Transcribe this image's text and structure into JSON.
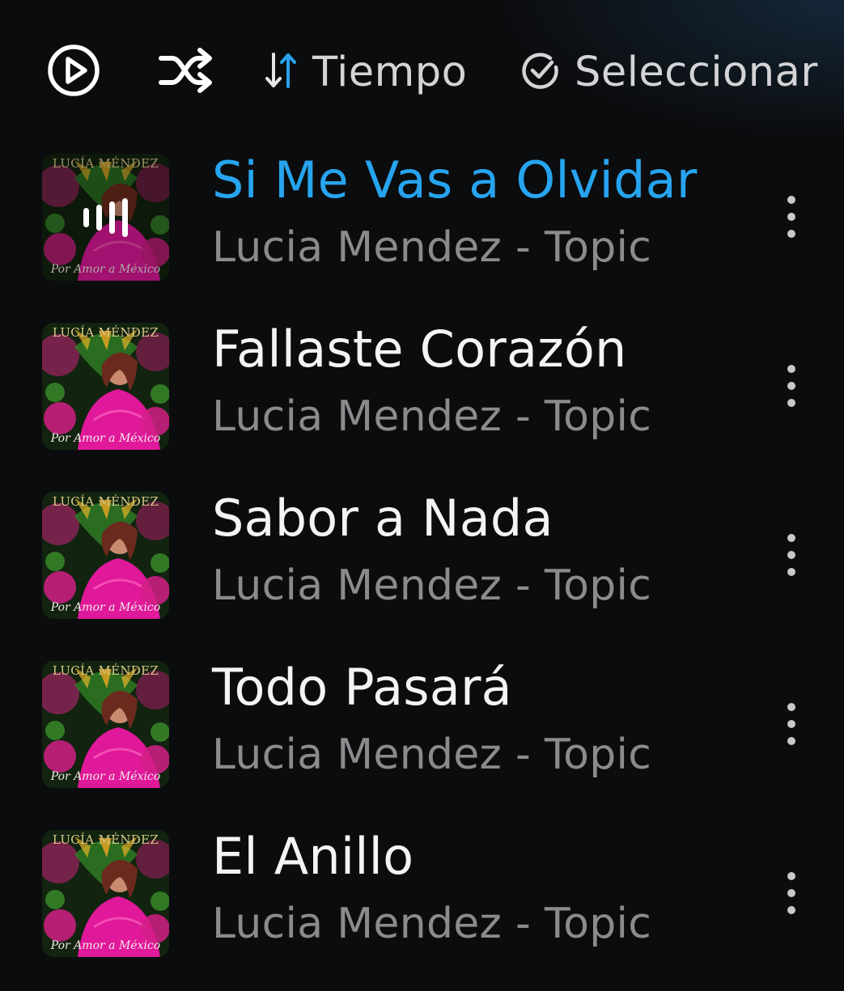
{
  "toolbar": {
    "play_icon": "play-circle-icon",
    "shuffle_icon": "shuffle-icon",
    "sort_icon": "sort-arrows-icon",
    "sort_label": "Tiempo",
    "select_icon": "check-circle-icon",
    "select_label": "Seleccionar"
  },
  "colors": {
    "background": "#0b0c0e",
    "now_playing_accent": "#27a4ef",
    "primary_text": "#f4f4f6",
    "secondary_text": "#8b8b8e"
  },
  "songs": [
    {
      "title": "Si Me Vas a Olvidar",
      "artist": "Lucia Mendez - Topic",
      "now_playing": true,
      "cover_artist": "LUCÍA MÉNDEZ",
      "cover_album": "Por Amor a México"
    },
    {
      "title": "Fallaste Corazón",
      "artist": "Lucia Mendez - Topic",
      "now_playing": false,
      "cover_artist": "LUCÍA MÉNDEZ",
      "cover_album": "Por Amor a México"
    },
    {
      "title": "Sabor a Nada",
      "artist": "Lucia Mendez - Topic",
      "now_playing": false,
      "cover_artist": "LUCÍA MÉNDEZ",
      "cover_album": "Por Amor a México"
    },
    {
      "title": "Todo Pasará",
      "artist": "Lucia Mendez - Topic",
      "now_playing": false,
      "cover_artist": "LUCÍA MÉNDEZ",
      "cover_album": "Por Amor a México"
    },
    {
      "title": "El Anillo",
      "artist": "Lucia Mendez - Topic",
      "now_playing": false,
      "cover_artist": "LUCÍA MÉNDEZ",
      "cover_album": "Por Amor a México"
    }
  ]
}
